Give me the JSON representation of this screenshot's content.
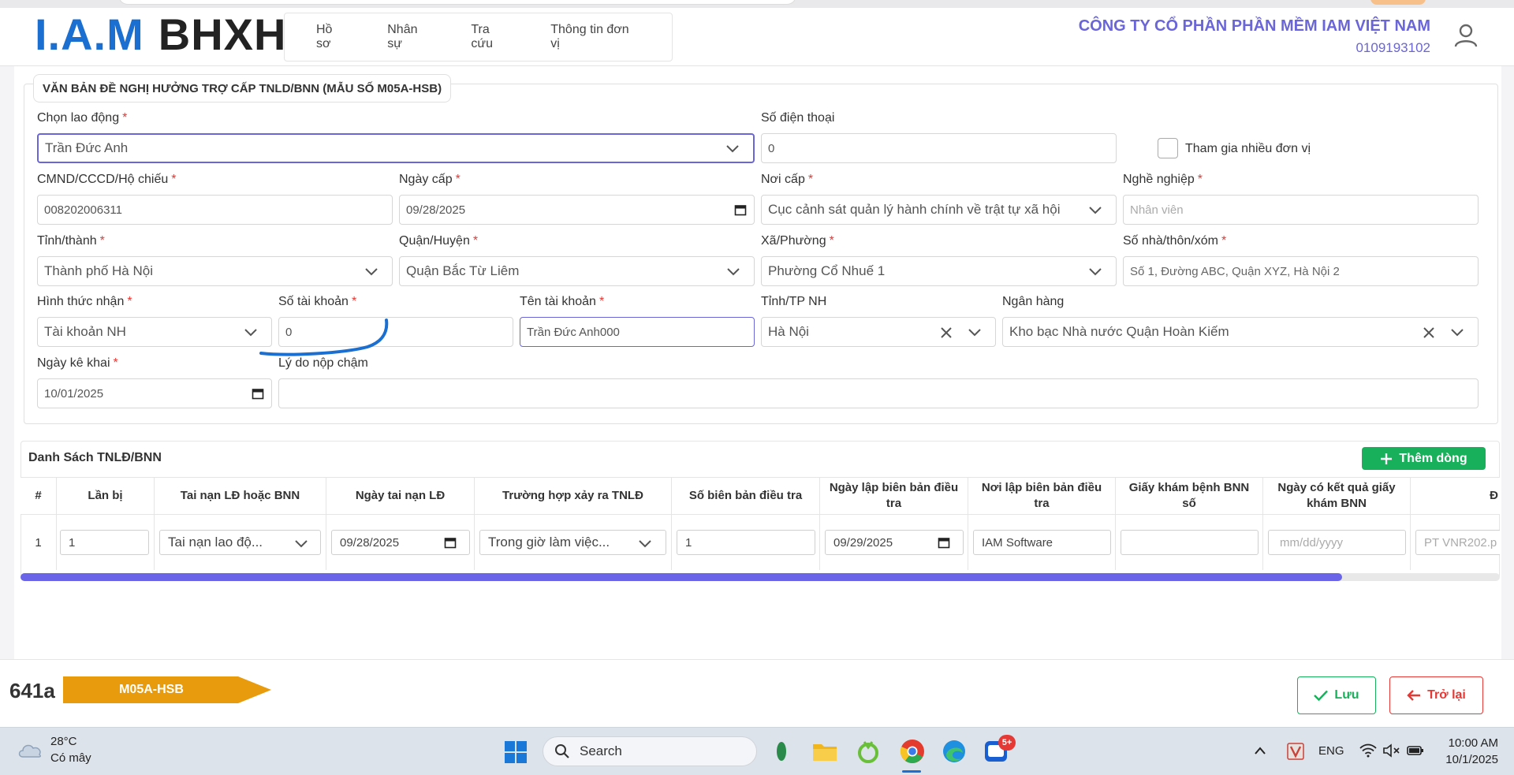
{
  "header": {
    "logo_left": "I.A.M",
    "logo_right": "BHXH",
    "nav": [
      "Hồ sơ",
      "Nhân sự",
      "Tra cứu",
      "Thông tin đơn vị"
    ],
    "company_name": "CÔNG TY CỔ PHẦN PHẦN MỀM IAM VIỆT NAM",
    "company_tax": "0109193102"
  },
  "form": {
    "legend": "VĂN BẢN ĐỀ NGHỊ HƯỞNG TRỢ CẤP TNLD/BNN (MẪU SỐ M05A-HSB)",
    "required_mark": "*",
    "employee": {
      "label": "Chọn lao động",
      "value": "Trần Đức Anh"
    },
    "phone": {
      "label": "Số điện thoại",
      "value": "0"
    },
    "multi_unit": {
      "label": "Tham gia nhiều đơn vị",
      "checked": false
    },
    "id_number": {
      "label": "CMND/CCCD/Hộ chiếu",
      "value": "008202006311"
    },
    "issue_date": {
      "label": "Ngày cấp",
      "value": "09/28/2025"
    },
    "issue_place": {
      "label": "Nơi cấp",
      "value": "Cục cảnh sát quản lý hành chính về trật tự xã hội"
    },
    "occupation": {
      "label": "Nghề nghiệp",
      "placeholder": "Nhân viên"
    },
    "province": {
      "label": "Tỉnh/thành",
      "value": "Thành phố Hà Nội"
    },
    "district": {
      "label": "Quận/Huyện",
      "value": "Quận Bắc Từ Liêm"
    },
    "ward": {
      "label": "Xã/Phường",
      "value": "Phường Cổ Nhuế 1"
    },
    "address": {
      "label": "Số nhà/thôn/xóm",
      "placeholder": "Số 1, Đường ABC, Quận XYZ, Hà Nội 2"
    },
    "receive_method": {
      "label": "Hình thức nhận",
      "value": "Tài khoản NH"
    },
    "account_number": {
      "label": "Số tài khoản",
      "value": "0"
    },
    "account_name": {
      "label": "Tên tài khoản",
      "value": "Trần Đức Anh000"
    },
    "bank_province": {
      "label": "Tỉnh/TP NH",
      "value": "Hà Nội"
    },
    "bank": {
      "label": "Ngân hàng",
      "value": "Kho bạc Nhà nước Quận Hoàn Kiếm"
    },
    "declare_date": {
      "label": "Ngày kê khai",
      "value": "10/01/2025"
    },
    "late_reason": {
      "label": "Lý do nộp chậm",
      "value": ""
    }
  },
  "table": {
    "title": "Danh Sách TNLĐ/BNN",
    "add_button": "Thêm dòng",
    "columns": [
      "#",
      "Lần bị",
      "Tai nạn LĐ hoặc BNN",
      "Ngày tai nạn LĐ",
      "Trường hợp xảy ra TNLĐ",
      "Số biên bản điều tra",
      "Ngày lập biên bản điều tra",
      "Nơi lập biên bản điều tra",
      "Giấy khám bệnh BNN số",
      "Ngày có kết quả giấy khám BNN",
      "Đ"
    ],
    "rows": [
      {
        "index": "1",
        "times": "1",
        "type": "Tai nạn lao độ...",
        "accident_date": "09/28/2025",
        "circumstance": "Trong giờ làm việc...",
        "report_number": "1",
        "report_date": "09/29/2025",
        "report_place": "IAM Software",
        "bnn_number": "",
        "result_date_placeholder": "mm/dd/yyyy",
        "next_placeholder": "PT VNR202.p"
      }
    ],
    "scroll_position": 0.89
  },
  "footer": {
    "code": "641a",
    "tag": "M05A-HSB",
    "save_label": "Lưu",
    "back_label": "Trở lại",
    "colors": {
      "tag": "#e89b0c",
      "save": "#18b05a",
      "back": "#e53935"
    }
  },
  "taskbar": {
    "temperature": "28°C",
    "weather": "Có mây",
    "search": "Search",
    "language": "ENG",
    "time": "10:00 AM",
    "date": "10/1/2025",
    "zalo_badge": "5+"
  }
}
